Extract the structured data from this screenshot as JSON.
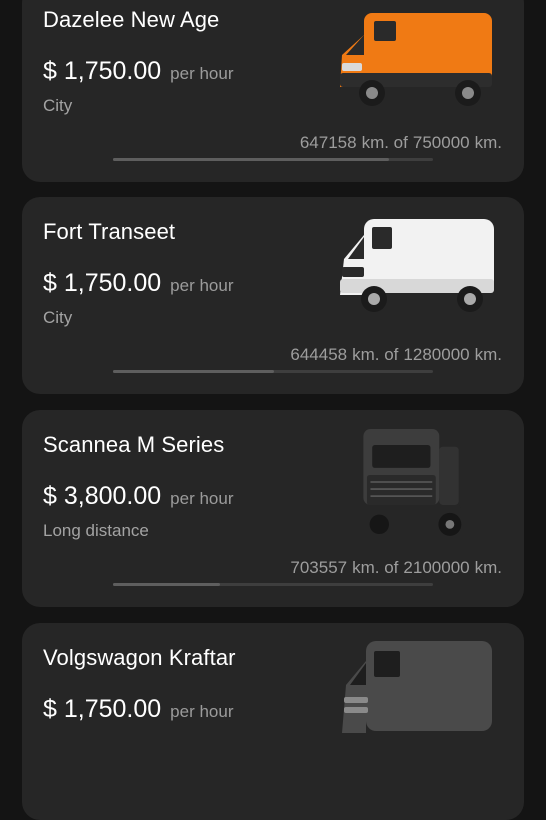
{
  "vehicles": [
    {
      "name": "Dazelee New Age",
      "price": "$ 1,750.00",
      "per": "per hour",
      "type": "City",
      "km_used": "647158",
      "km_of": "km. of",
      "km_total": "750000",
      "km_unit": "km.",
      "progress": 0.863,
      "color": "#f07a14",
      "icon": "orange-van-image"
    },
    {
      "name": "Fort Transeet",
      "price": "$ 1,750.00",
      "per": "per hour",
      "type": "City",
      "km_used": "644458",
      "km_of": "km. of",
      "km_total": "1280000",
      "km_unit": "km.",
      "progress": 0.503,
      "color": "#f2f2f2",
      "icon": "white-van-image"
    },
    {
      "name": "Scannea M Series",
      "price": "$ 3,800.00",
      "per": "per hour",
      "type": "Long distance",
      "km_used": "703557",
      "km_of": "km. of",
      "km_total": "2100000",
      "km_unit": "km.",
      "progress": 0.335,
      "color": "#3d3d3d",
      "icon": "truck-tractor-image"
    },
    {
      "name": "Volgswagon Kraftar",
      "price": "$ 1,750.00",
      "per": "per hour",
      "color": "#4a4a4a",
      "icon": "dark-van-image"
    }
  ]
}
